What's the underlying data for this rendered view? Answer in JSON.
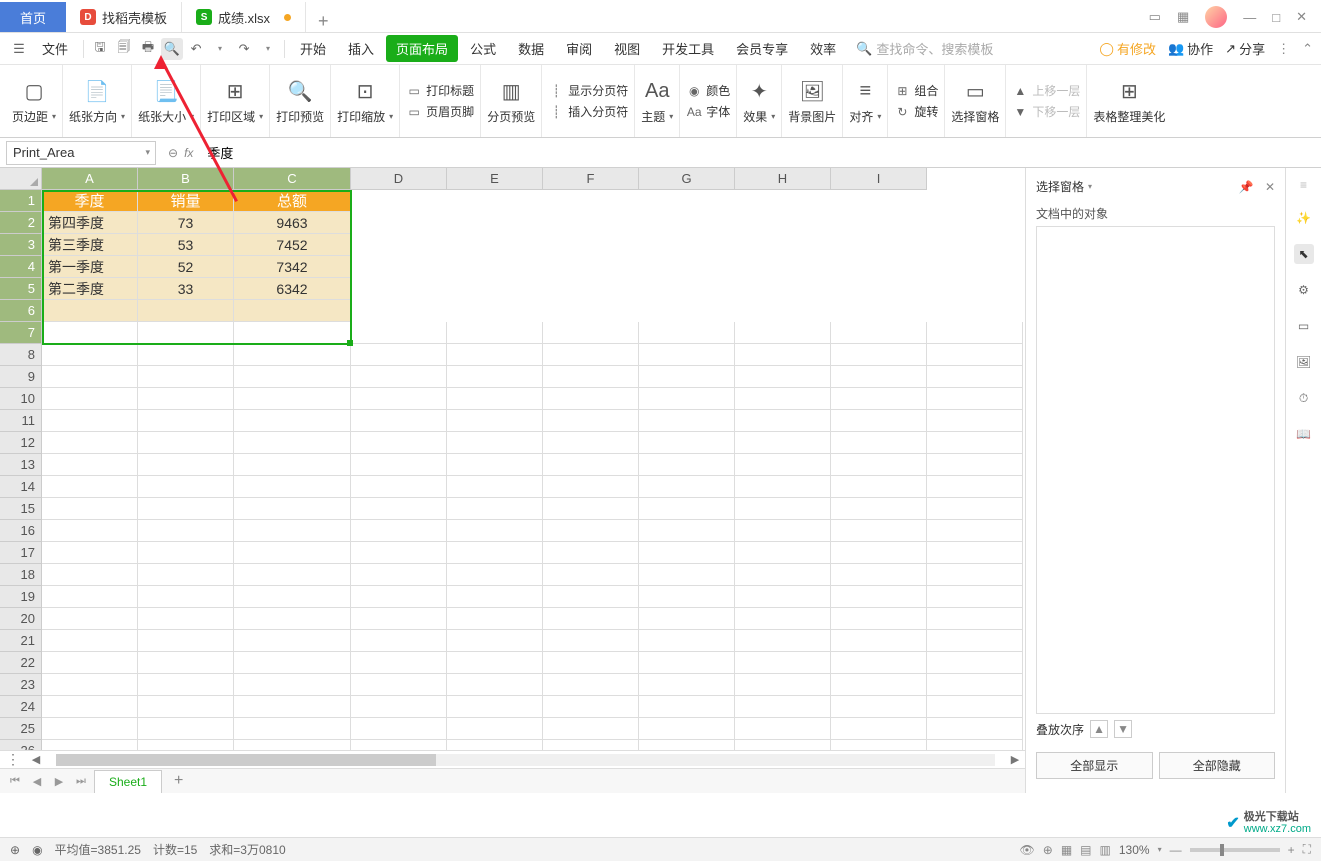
{
  "tabs": {
    "home": "首页",
    "doc1": "找稻壳模板",
    "doc2": "成绩.xlsx",
    "plus": "+"
  },
  "window": {
    "min": "—",
    "max": "□",
    "close": "✕"
  },
  "menubar": {
    "file": "文件",
    "items": [
      "开始",
      "插入",
      "页面布局",
      "公式",
      "数据",
      "审阅",
      "视图",
      "开发工具",
      "会员专享",
      "效率"
    ],
    "search_ph": "查找命令、搜索模板",
    "right": {
      "changes": "有修改",
      "collab": "协作",
      "share": "分享"
    }
  },
  "ribbon": {
    "g1": "页边距",
    "g2": "纸张方向",
    "g3": "纸张大小",
    "g4": "打印区域",
    "g5": "打印预览",
    "g6": "打印缩放",
    "g7a": "打印标题",
    "g7b": "页眉页脚",
    "g8": "分页预览",
    "g9a": "显示分页符",
    "g9b": "插入分页符",
    "g10": "主题",
    "g11a": "颜色",
    "g11b": "字体",
    "g12": "效果",
    "g13": "背景图片",
    "g14": "对齐",
    "g15a": "组合",
    "g15b": "旋转",
    "g16": "选择窗格",
    "g17a": "上移一层",
    "g17b": "下移一层",
    "g18": "表格整理美化"
  },
  "formula": {
    "namebox": "Print_Area",
    "value": "季度"
  },
  "columns": [
    "A",
    "B",
    "C",
    "D",
    "E",
    "F",
    "G",
    "H",
    "I"
  ],
  "table": {
    "headers": [
      "季度",
      "销量",
      "总额"
    ],
    "rows": [
      [
        "第四季度",
        "73",
        "9463"
      ],
      [
        "第三季度",
        "53",
        "7452"
      ],
      [
        "第一季度",
        "52",
        "7342"
      ],
      [
        "第二季度",
        "33",
        "6342"
      ]
    ]
  },
  "sheet_tab": "Sheet1",
  "rightpane": {
    "title": "选择窗格",
    "subtitle": "文档中的对象",
    "order": "叠放次序",
    "btn1": "全部显示",
    "btn2": "全部隐藏"
  },
  "status": {
    "avg": "平均值=3851.25",
    "count": "计数=15",
    "sum": "求和=3万0810",
    "zoom": "130%"
  },
  "watermark": {
    "name": "极光下载站",
    "url": "www.xz7.com"
  }
}
